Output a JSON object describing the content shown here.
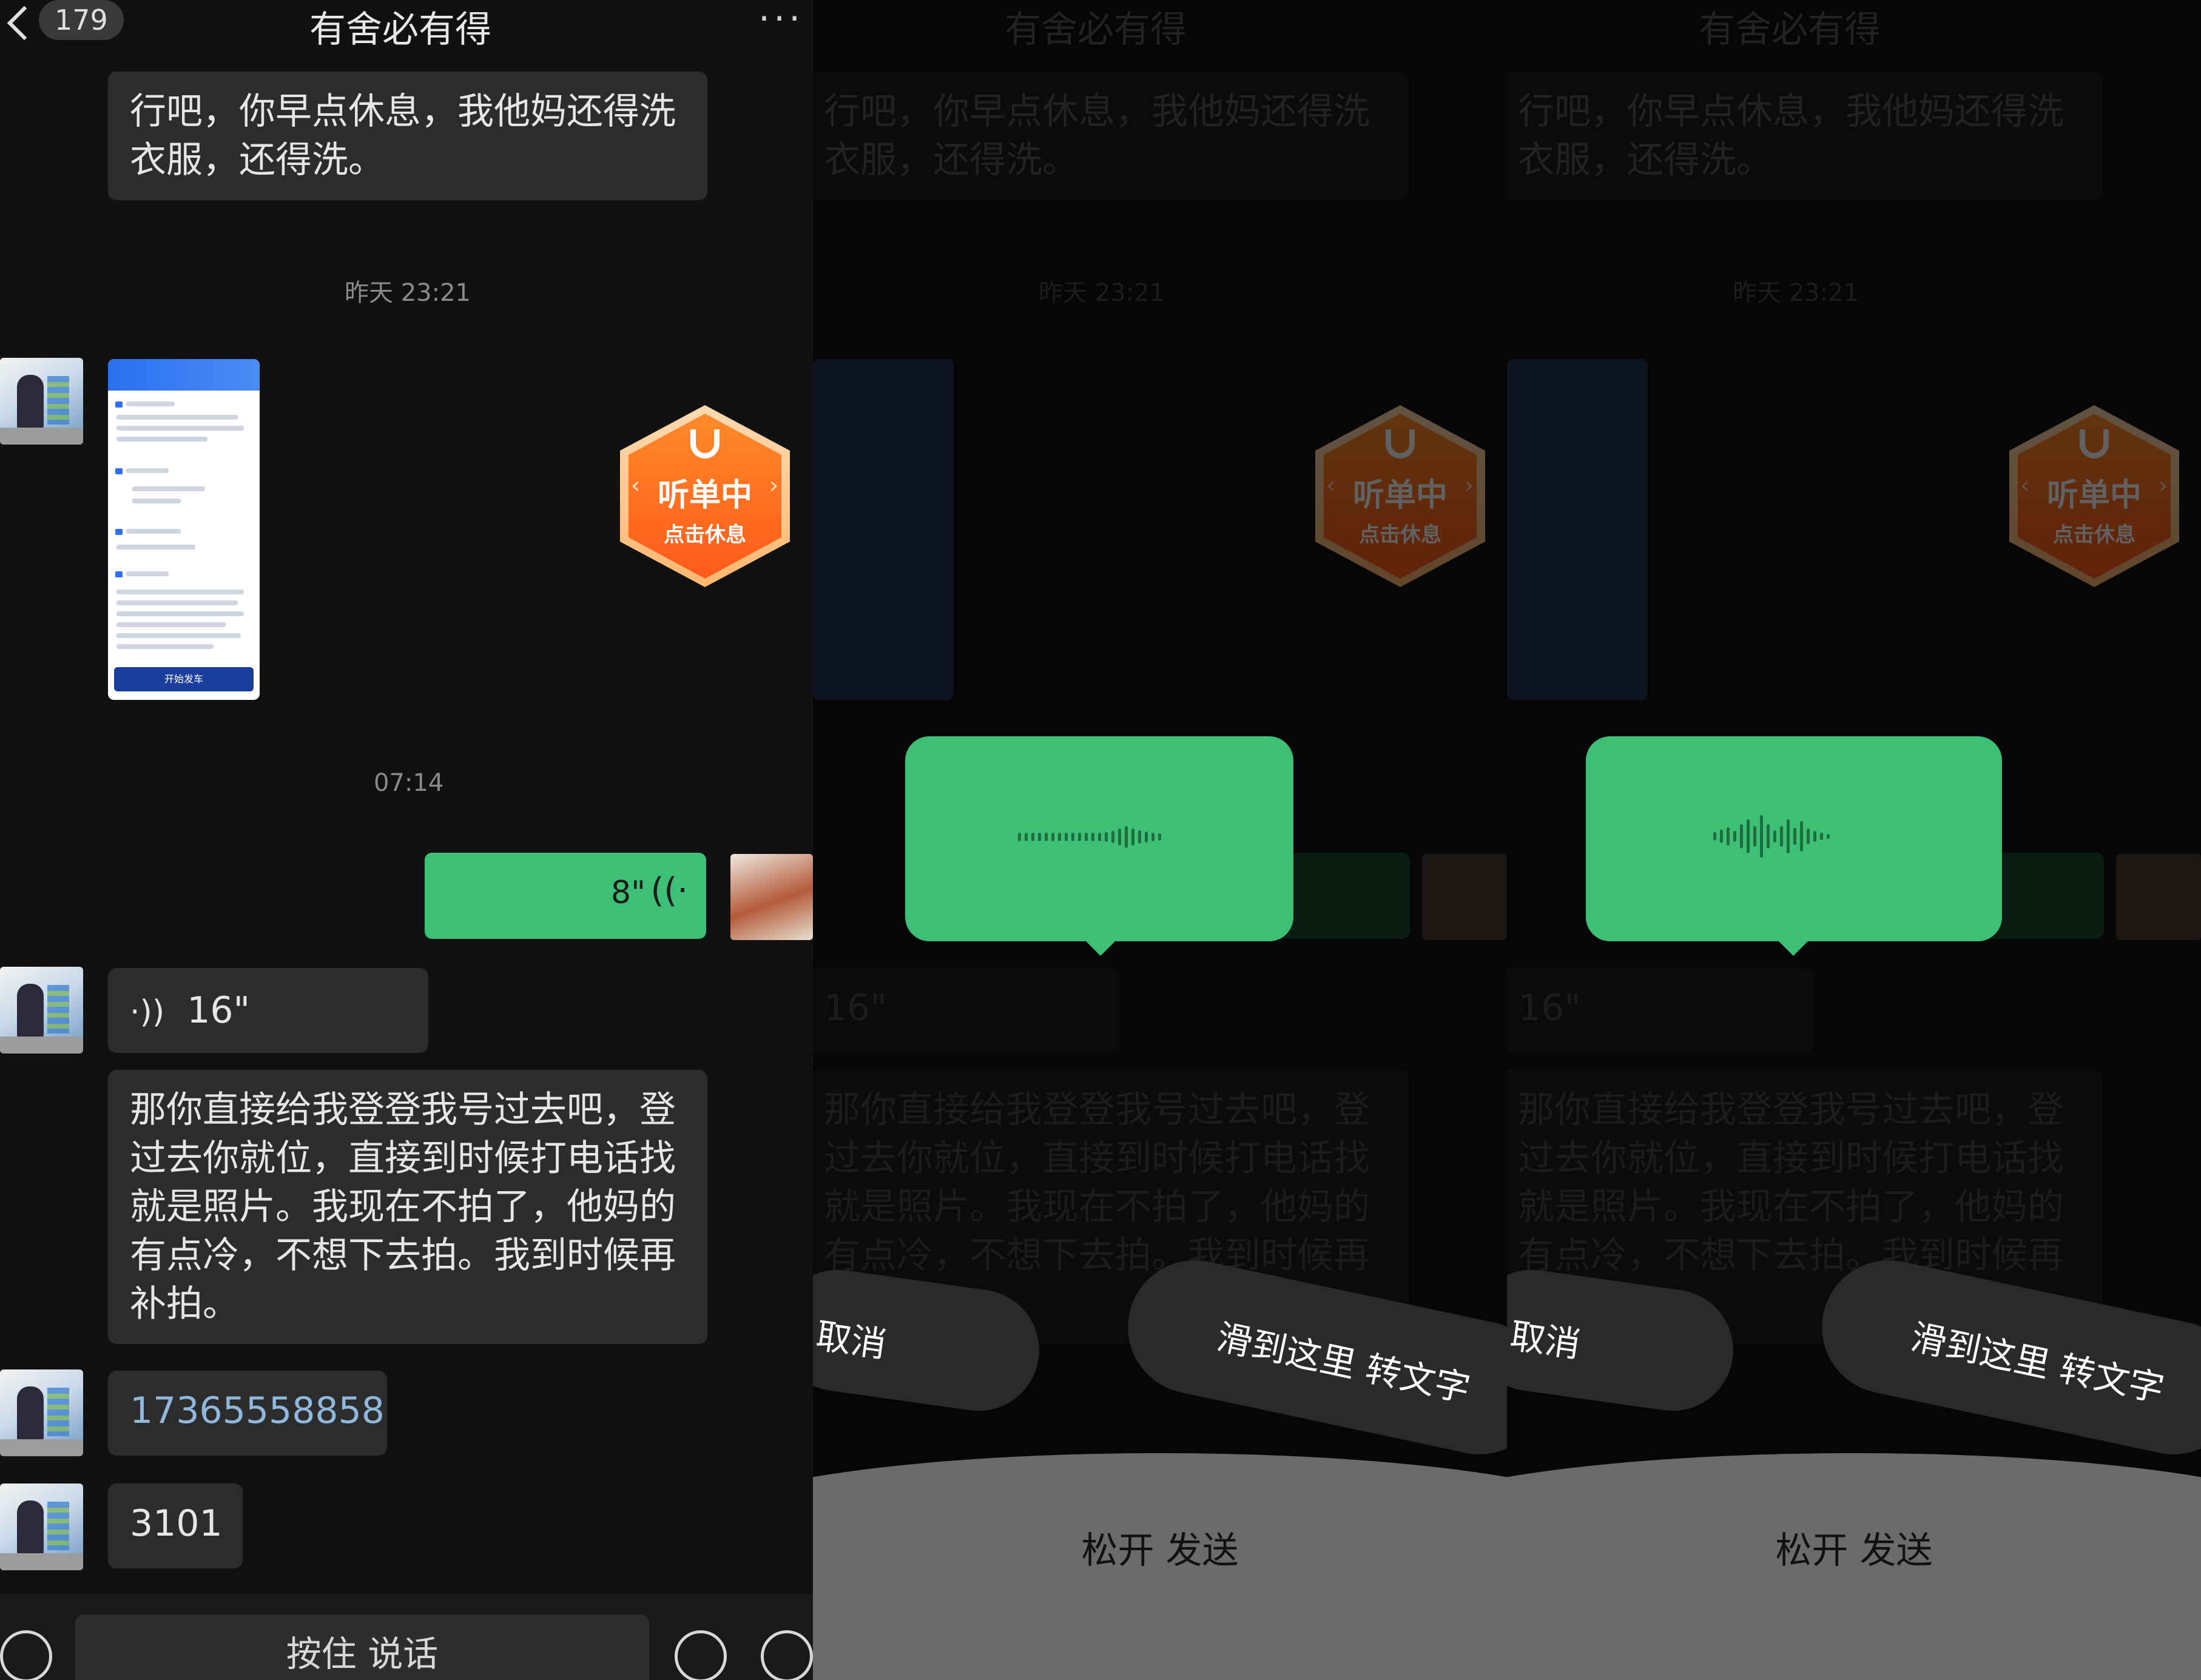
{
  "header": {
    "title": "有舍必有得",
    "unread_count": "179",
    "more_label": "···"
  },
  "messages": {
    "msg1_text": "行吧，你早点休息，我他妈还得洗衣服，还得洗。",
    "time1": "昨天 23:21",
    "thumb_btn": "开始发车",
    "time2": "07:14",
    "my_voice_duration": "8\"",
    "voice_duration": "16\"",
    "msg_long_text": "那你直接给我登登我号过去吧，登过去你就位，直接到时候打电话找就是照片。我现在不拍了，他妈的有点冷，不想下去拍。我到时候再补拍。",
    "phone_number": "17365558858",
    "code_text": "3101"
  },
  "badge": {
    "line1": "听单中",
    "line2": "点击休息"
  },
  "input": {
    "hold_to_talk": "按住 说话"
  },
  "record": {
    "cancel_label": "取消",
    "to_text_label": "滑到这里 转文字",
    "release_label": "松开 发送"
  },
  "colors": {
    "accent_green": "#3dbf75",
    "badge_orange": "#ff6a1f",
    "background": "#111111",
    "bubble": "#2c2c2c"
  },
  "icons": [
    "back-chevron-icon",
    "more-icon",
    "keyboard-icon",
    "emoji-icon",
    "plus-icon",
    "voice-wave-icon",
    "didi-logo-icon"
  ]
}
